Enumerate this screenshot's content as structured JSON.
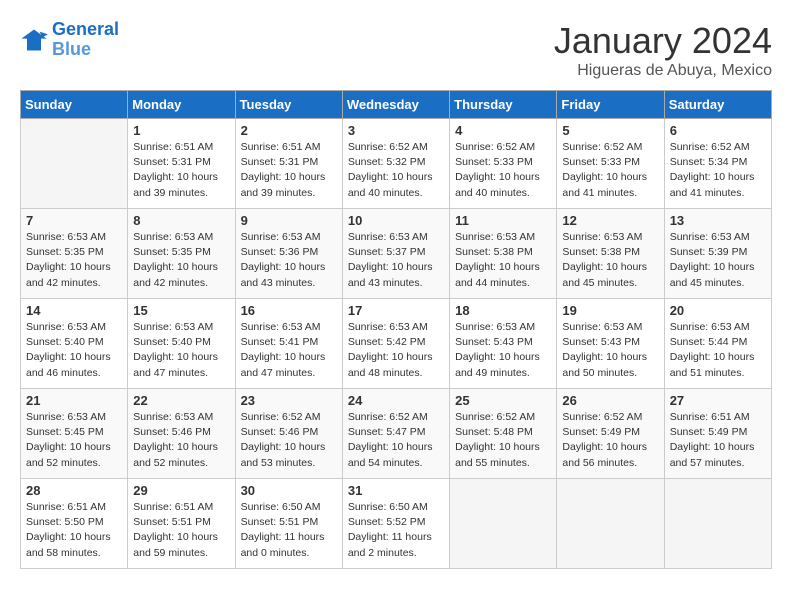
{
  "header": {
    "logo_line1": "General",
    "logo_line2": "Blue",
    "month": "January 2024",
    "location": "Higueras de Abuya, Mexico"
  },
  "weekdays": [
    "Sunday",
    "Monday",
    "Tuesday",
    "Wednesday",
    "Thursday",
    "Friday",
    "Saturday"
  ],
  "weeks": [
    [
      {
        "day": "",
        "info": ""
      },
      {
        "day": "1",
        "info": "Sunrise: 6:51 AM\nSunset: 5:31 PM\nDaylight: 10 hours\nand 39 minutes."
      },
      {
        "day": "2",
        "info": "Sunrise: 6:51 AM\nSunset: 5:31 PM\nDaylight: 10 hours\nand 39 minutes."
      },
      {
        "day": "3",
        "info": "Sunrise: 6:52 AM\nSunset: 5:32 PM\nDaylight: 10 hours\nand 40 minutes."
      },
      {
        "day": "4",
        "info": "Sunrise: 6:52 AM\nSunset: 5:33 PM\nDaylight: 10 hours\nand 40 minutes."
      },
      {
        "day": "5",
        "info": "Sunrise: 6:52 AM\nSunset: 5:33 PM\nDaylight: 10 hours\nand 41 minutes."
      },
      {
        "day": "6",
        "info": "Sunrise: 6:52 AM\nSunset: 5:34 PM\nDaylight: 10 hours\nand 41 minutes."
      }
    ],
    [
      {
        "day": "7",
        "info": "Sunrise: 6:53 AM\nSunset: 5:35 PM\nDaylight: 10 hours\nand 42 minutes."
      },
      {
        "day": "8",
        "info": "Sunrise: 6:53 AM\nSunset: 5:35 PM\nDaylight: 10 hours\nand 42 minutes."
      },
      {
        "day": "9",
        "info": "Sunrise: 6:53 AM\nSunset: 5:36 PM\nDaylight: 10 hours\nand 43 minutes."
      },
      {
        "day": "10",
        "info": "Sunrise: 6:53 AM\nSunset: 5:37 PM\nDaylight: 10 hours\nand 43 minutes."
      },
      {
        "day": "11",
        "info": "Sunrise: 6:53 AM\nSunset: 5:38 PM\nDaylight: 10 hours\nand 44 minutes."
      },
      {
        "day": "12",
        "info": "Sunrise: 6:53 AM\nSunset: 5:38 PM\nDaylight: 10 hours\nand 45 minutes."
      },
      {
        "day": "13",
        "info": "Sunrise: 6:53 AM\nSunset: 5:39 PM\nDaylight: 10 hours\nand 45 minutes."
      }
    ],
    [
      {
        "day": "14",
        "info": "Sunrise: 6:53 AM\nSunset: 5:40 PM\nDaylight: 10 hours\nand 46 minutes."
      },
      {
        "day": "15",
        "info": "Sunrise: 6:53 AM\nSunset: 5:40 PM\nDaylight: 10 hours\nand 47 minutes."
      },
      {
        "day": "16",
        "info": "Sunrise: 6:53 AM\nSunset: 5:41 PM\nDaylight: 10 hours\nand 47 minutes."
      },
      {
        "day": "17",
        "info": "Sunrise: 6:53 AM\nSunset: 5:42 PM\nDaylight: 10 hours\nand 48 minutes."
      },
      {
        "day": "18",
        "info": "Sunrise: 6:53 AM\nSunset: 5:43 PM\nDaylight: 10 hours\nand 49 minutes."
      },
      {
        "day": "19",
        "info": "Sunrise: 6:53 AM\nSunset: 5:43 PM\nDaylight: 10 hours\nand 50 minutes."
      },
      {
        "day": "20",
        "info": "Sunrise: 6:53 AM\nSunset: 5:44 PM\nDaylight: 10 hours\nand 51 minutes."
      }
    ],
    [
      {
        "day": "21",
        "info": "Sunrise: 6:53 AM\nSunset: 5:45 PM\nDaylight: 10 hours\nand 52 minutes."
      },
      {
        "day": "22",
        "info": "Sunrise: 6:53 AM\nSunset: 5:46 PM\nDaylight: 10 hours\nand 52 minutes."
      },
      {
        "day": "23",
        "info": "Sunrise: 6:52 AM\nSunset: 5:46 PM\nDaylight: 10 hours\nand 53 minutes."
      },
      {
        "day": "24",
        "info": "Sunrise: 6:52 AM\nSunset: 5:47 PM\nDaylight: 10 hours\nand 54 minutes."
      },
      {
        "day": "25",
        "info": "Sunrise: 6:52 AM\nSunset: 5:48 PM\nDaylight: 10 hours\nand 55 minutes."
      },
      {
        "day": "26",
        "info": "Sunrise: 6:52 AM\nSunset: 5:49 PM\nDaylight: 10 hours\nand 56 minutes."
      },
      {
        "day": "27",
        "info": "Sunrise: 6:51 AM\nSunset: 5:49 PM\nDaylight: 10 hours\nand 57 minutes."
      }
    ],
    [
      {
        "day": "28",
        "info": "Sunrise: 6:51 AM\nSunset: 5:50 PM\nDaylight: 10 hours\nand 58 minutes."
      },
      {
        "day": "29",
        "info": "Sunrise: 6:51 AM\nSunset: 5:51 PM\nDaylight: 10 hours\nand 59 minutes."
      },
      {
        "day": "30",
        "info": "Sunrise: 6:50 AM\nSunset: 5:51 PM\nDaylight: 11 hours\nand 0 minutes."
      },
      {
        "day": "31",
        "info": "Sunrise: 6:50 AM\nSunset: 5:52 PM\nDaylight: 11 hours\nand 2 minutes."
      },
      {
        "day": "",
        "info": ""
      },
      {
        "day": "",
        "info": ""
      },
      {
        "day": "",
        "info": ""
      }
    ]
  ]
}
